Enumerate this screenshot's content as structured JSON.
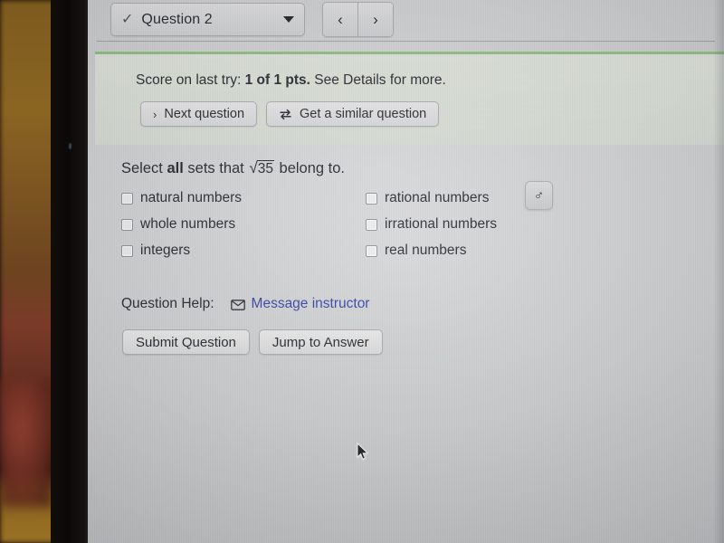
{
  "topbar": {
    "question_selector": {
      "check_icon": "checkmark-icon",
      "label": "Question 2",
      "caret_icon": "chevron-down-icon"
    },
    "prev_label": "‹",
    "next_label": "›"
  },
  "score_panel": {
    "prefix": "Score on last try: ",
    "points": "1 of 1 pts.",
    "suffix": " See Details for more.",
    "next_question_button": {
      "chevron": "›",
      "label": "Next question"
    },
    "similar_question_button": {
      "icon": "swap-arrows-icon",
      "label": "Get a similar question"
    },
    "accent_color": "#8fbe82"
  },
  "question": {
    "text_before": "Select ",
    "emphasis": "all",
    "text_middle": " sets that ",
    "radical_sign": "√",
    "radicand": "35",
    "text_after": " belong to.",
    "choices": [
      {
        "label": "natural numbers",
        "checked": false
      },
      {
        "label": "rational numbers",
        "checked": false
      },
      {
        "label": "whole numbers",
        "checked": false
      },
      {
        "label": "irrational numbers",
        "checked": false
      },
      {
        "label": "integers",
        "checked": false
      },
      {
        "label": "real numbers",
        "checked": false
      }
    ],
    "tool_button": {
      "icon": "mars-symbol-icon",
      "glyph": "♂"
    }
  },
  "help": {
    "label": "Question Help:",
    "mail_icon": "envelope-icon",
    "link_label": "Message instructor",
    "link_color": "#2b3aa0"
  },
  "actions": {
    "submit_label": "Submit Question",
    "jump_label": "Jump to Answer"
  },
  "pointer": {
    "icon": "mouse-cursor-icon"
  }
}
